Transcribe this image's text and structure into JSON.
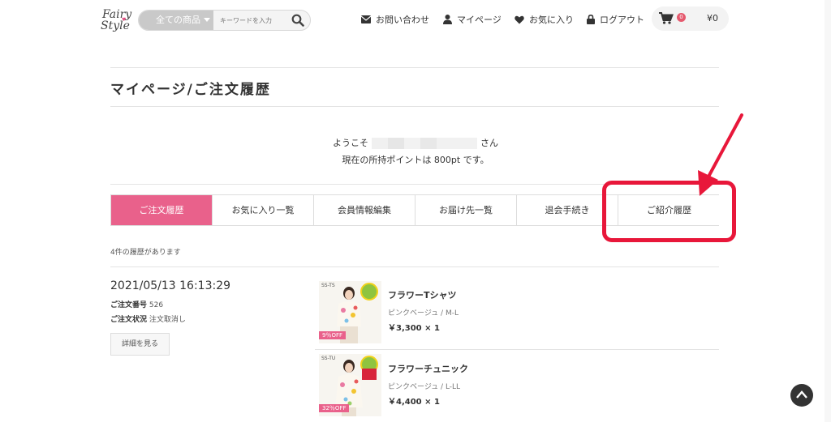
{
  "header": {
    "logo_line1": "Fairy",
    "logo_line2": "Style",
    "search_category": "全ての商品",
    "search_placeholder": "キーワードを入力",
    "nav": {
      "contact": "お問い合わせ",
      "mypage": "マイページ",
      "favorites": "お気に入り",
      "logout": "ログアウト"
    },
    "cart_count": "0",
    "cart_total": "¥0"
  },
  "page": {
    "title": "マイページ/ご注文履歴",
    "welcome_prefix": "ようこそ",
    "welcome_suffix": "さん",
    "points_text": "現在の所持ポイントは 800pt です。"
  },
  "tabs": [
    {
      "label": "ご注文履歴",
      "active": true
    },
    {
      "label": "お気に入り一覧",
      "active": false
    },
    {
      "label": "会員情報編集",
      "active": false
    },
    {
      "label": "お届け先一覧",
      "active": false
    },
    {
      "label": "退会手続き",
      "active": false
    },
    {
      "label": "ご紹介履歴",
      "active": false
    }
  ],
  "history_count_text": "4件の履歴があります",
  "order": {
    "datetime": "2021/05/13 16:13:29",
    "number_label": "ご注文番号",
    "number": "526",
    "status_label": "ご注文状況",
    "status": "注文取消し",
    "detail_button": "詳細を見る",
    "items": [
      {
        "code": "SS-TS",
        "discount": "9％OFF",
        "name": "フラワーTシャツ",
        "variant": "ピンクベージュ / M-L",
        "price": "￥3,300 × 1"
      },
      {
        "code": "SS-TU",
        "discount": "32％OFF",
        "name": "フラワーチュニック",
        "variant": "ピンクベージュ / L-LL",
        "price": "￥4,400 × 1"
      }
    ]
  },
  "colors": {
    "accent": "#e9618b",
    "highlight": "#e8173a"
  }
}
